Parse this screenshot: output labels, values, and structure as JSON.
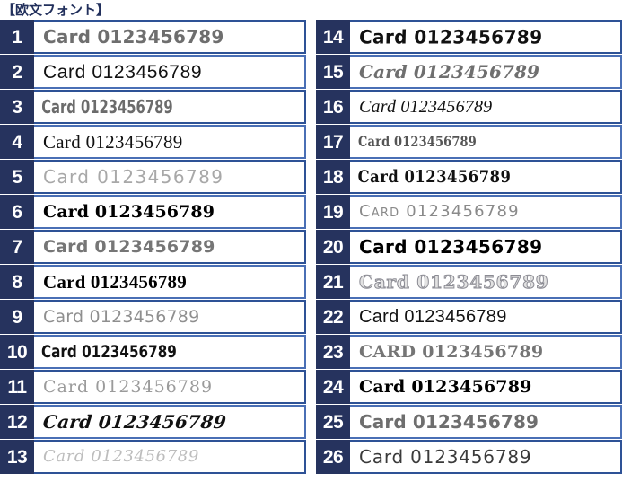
{
  "header": {
    "title": "【欧文フォント】"
  },
  "colors": {
    "header_text": "#22305c",
    "number_box_bg": "#26335e",
    "number_box_text": "#ffffff",
    "row_border": "#4a6fb5",
    "row_border_dark": "#2e5296",
    "page_bg": "#ffffff"
  },
  "table": {
    "sample_text_default": "Card 0123456789",
    "columns": [
      {
        "name": "left-column",
        "rows": [
          {
            "number": "1",
            "sample": "Card 0123456789",
            "style": "f1",
            "border": "dark"
          },
          {
            "number": "2",
            "sample": "Card 0123456789",
            "style": "f2",
            "border": "light"
          },
          {
            "number": "3",
            "sample": "Card 0123456789",
            "style": "f3",
            "border": "dark"
          },
          {
            "number": "4",
            "sample": "Card 0123456789",
            "style": "f4",
            "border": "light"
          },
          {
            "number": "5",
            "sample": "Card 0123456789",
            "style": "f5",
            "border": "dark"
          },
          {
            "number": "6",
            "sample": "Card 0123456789",
            "style": "f6",
            "border": "light"
          },
          {
            "number": "7",
            "sample": "Card 0123456789",
            "style": "f7",
            "border": "dark"
          },
          {
            "number": "8",
            "sample": "Card 0123456789",
            "style": "f8",
            "border": "light"
          },
          {
            "number": "9",
            "sample": "Card 0123456789",
            "style": "f9",
            "border": "dark"
          },
          {
            "number": "10",
            "sample": "Card 0123456789",
            "style": "f10",
            "border": "light"
          },
          {
            "number": "11",
            "sample": "Card 0123456789",
            "style": "f11",
            "border": "dark"
          },
          {
            "number": "12",
            "sample": "Card 0123456789",
            "style": "f12",
            "border": "light"
          },
          {
            "number": "13",
            "sample": "Card 0123456789",
            "style": "f13",
            "border": "dark"
          }
        ]
      },
      {
        "name": "right-column",
        "rows": [
          {
            "number": "14",
            "sample": "Card 0123456789",
            "style": "f14",
            "border": "dark"
          },
          {
            "number": "15",
            "sample": "Card 0123456789",
            "style": "f15",
            "border": "light"
          },
          {
            "number": "16",
            "sample": "Card 0123456789",
            "style": "f16",
            "border": "dark"
          },
          {
            "number": "17",
            "sample": "Card 0123456789",
            "style": "f17",
            "border": "light"
          },
          {
            "number": "18",
            "sample": "Card 0123456789",
            "style": "f18",
            "border": "dark"
          },
          {
            "number": "19",
            "sample": "Card 0123456789",
            "style": "f19",
            "border": "light"
          },
          {
            "number": "20",
            "sample": "Card 0123456789",
            "style": "f20",
            "border": "dark"
          },
          {
            "number": "21",
            "sample": "Card 0123456789",
            "style": "f21",
            "border": "light"
          },
          {
            "number": "22",
            "sample": "Card 0123456789",
            "style": "f22",
            "border": "dark"
          },
          {
            "number": "23",
            "sample": "CARD 0123456789",
            "style": "f23",
            "border": "light"
          },
          {
            "number": "24",
            "sample": "Card 0123456789",
            "style": "f24",
            "border": "dark"
          },
          {
            "number": "25",
            "sample": "Card 0123456789",
            "style": "f25",
            "border": "light"
          },
          {
            "number": "26",
            "sample": "Card 0123456789",
            "style": "f26",
            "border": "dark"
          }
        ]
      }
    ]
  }
}
